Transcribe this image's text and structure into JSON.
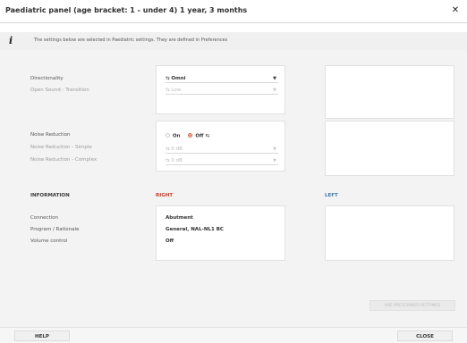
{
  "window": {
    "title": "Paediatric panel (age bracket: 1 - under 4) 1 year, 3 months"
  },
  "info": {
    "text": "The settings below are selected in Paediatric settings. They are defined in Preferences"
  },
  "settings": {
    "directionality": {
      "label": "Directionality",
      "value": "Omni"
    },
    "open_sound": {
      "label": "Open Sound - Transition",
      "value": "Low"
    },
    "noise_reduction": {
      "label": "Noise Reduction",
      "options": [
        "On",
        "Off"
      ],
      "selected": "Off"
    },
    "nr_simple": {
      "label": "Noise Reduction - Simple",
      "value": "0 dB"
    },
    "nr_complex": {
      "label": "Noise Reduction - Complex",
      "value": "0 dB"
    }
  },
  "information": {
    "header": "INFORMATION",
    "right_header": "RIGHT",
    "left_header": "LEFT",
    "rows": [
      {
        "label": "Connection",
        "right": "Abutment"
      },
      {
        "label": "Program / Rationale",
        "right": "General, NAL-NL1 BC"
      },
      {
        "label": "Volume control",
        "right": "Off"
      }
    ]
  },
  "buttons": {
    "use_prescribed": "USE PRESCRIBED SETTINGS",
    "help": "HELP",
    "close": "CLOSE"
  },
  "colors": {
    "right_accent": "#d9381e",
    "left_accent": "#3a78b5",
    "radio_selected": "#e8623b"
  },
  "icons": {
    "close": "close-icon",
    "info": "info-icon",
    "link": "link-icon",
    "dropdown": "chevron-down-icon"
  }
}
